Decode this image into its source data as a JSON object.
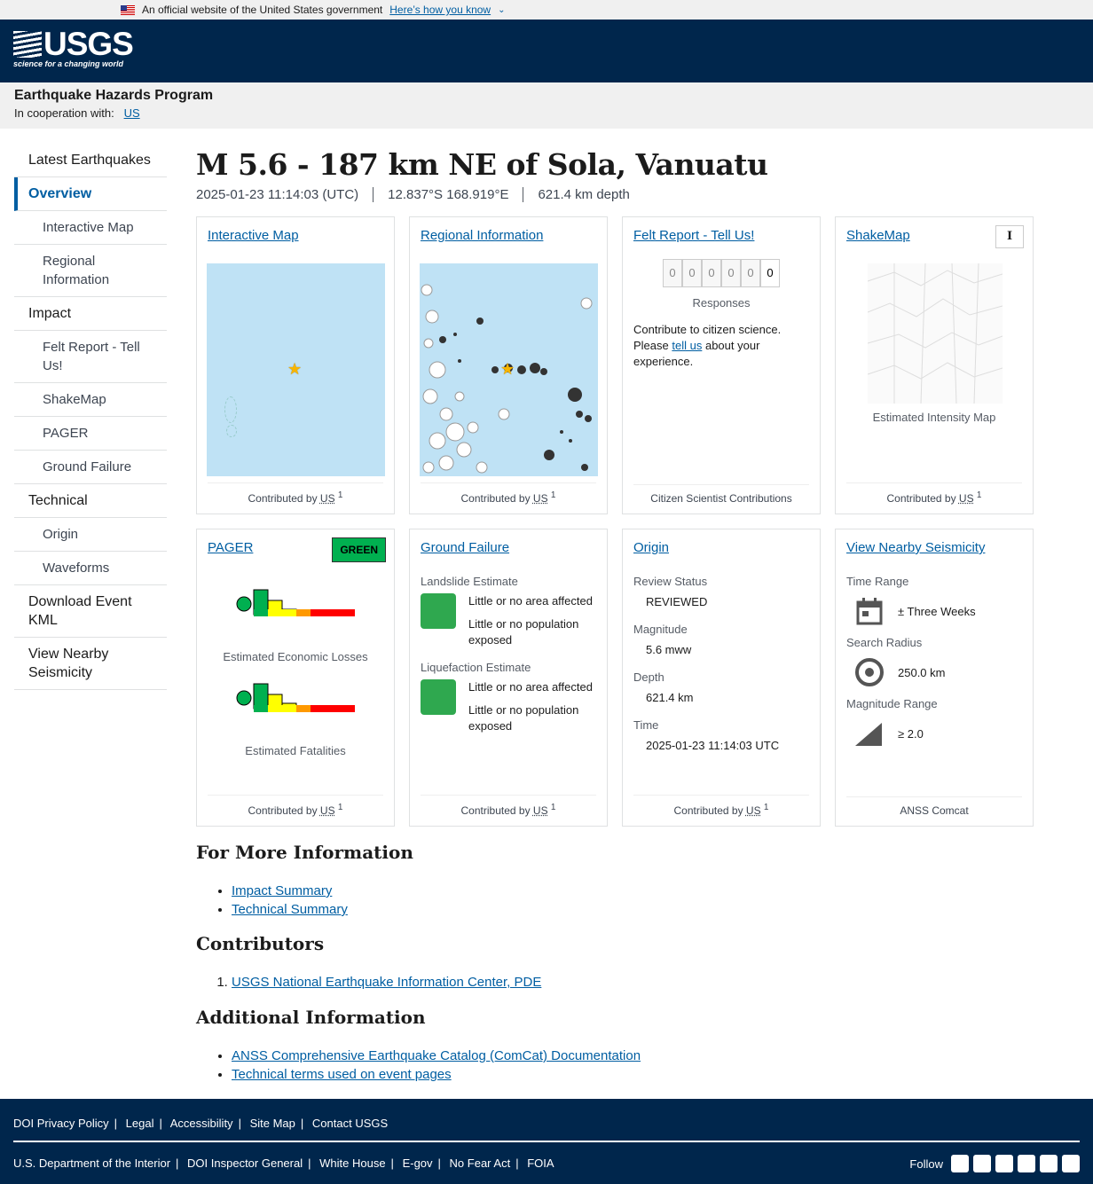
{
  "gov": {
    "text": "An official website of the United States government",
    "link": "Here’s how you know"
  },
  "brand": {
    "name": "USGS",
    "tagline": "science for a changing world"
  },
  "program": {
    "name": "Earthquake Hazards Program",
    "coop_label": "In cooperation with:",
    "coop_link": "US"
  },
  "nav": [
    {
      "label": "Latest Earthquakes"
    },
    {
      "label": "Overview"
    },
    {
      "label": "Interactive Map"
    },
    {
      "label": "Regional Information"
    },
    {
      "label": "Impact"
    },
    {
      "label": "Felt Report - Tell Us!"
    },
    {
      "label": "ShakeMap"
    },
    {
      "label": "PAGER"
    },
    {
      "label": "Ground Failure"
    },
    {
      "label": "Technical"
    },
    {
      "label": "Origin"
    },
    {
      "label": "Waveforms"
    },
    {
      "label": "Download Event KML"
    },
    {
      "label": "View Nearby Seismicity"
    }
  ],
  "event": {
    "title": "M 5.6 - 187 km NE of Sola, Vanuatu",
    "time": "2025-01-23 11:14:03 (UTC)",
    "location": "12.837°S 168.919°E",
    "depth": "621.4 km depth"
  },
  "cards": {
    "interactive_map": {
      "title": "Interactive Map",
      "foot": "Contributed by",
      "src": "US",
      "sup": "1"
    },
    "regional": {
      "title": "Regional Information",
      "foot": "Contributed by",
      "src": "US",
      "sup": "1"
    },
    "felt": {
      "title": "Felt Report - Tell Us!",
      "digits": [
        "0",
        "0",
        "0",
        "0",
        "0",
        "0"
      ],
      "responses": "Responses",
      "text1": "Contribute to citizen science. Please",
      "link": "tell us",
      "text2": "about your experience.",
      "foot": "Citizen Scientist Contributions"
    },
    "shakemap": {
      "title": "ShakeMap",
      "mmi": "I",
      "caption": "Estimated Intensity Map",
      "foot": "Contributed by",
      "src": "US",
      "sup": "1"
    },
    "pager": {
      "title": "PAGER",
      "alert": "GREEN",
      "cap1": "Estimated Economic Losses",
      "cap2": "Estimated Fatalities",
      "foot": "Contributed by",
      "src": "US",
      "sup": "1"
    },
    "ground": {
      "title": "Ground Failure",
      "ls_label": "Landslide Estimate",
      "ls_area": "Little or no area affected",
      "ls_pop": "Little or no population exposed",
      "lq_label": "Liquefaction Estimate",
      "lq_area": "Little or no area affected",
      "lq_pop": "Little or no population exposed",
      "foot": "Contributed by",
      "src": "US",
      "sup": "1"
    },
    "origin": {
      "title": "Origin",
      "review_label": "Review Status",
      "review": "REVIEWED",
      "mag_label": "Magnitude",
      "mag": "5.6 mww",
      "depth_label": "Depth",
      "depth": "621.4 km",
      "time_label": "Time",
      "time": "2025-01-23 11:14:03 UTC",
      "foot": "Contributed by",
      "src": "US",
      "sup": "1"
    },
    "nearby": {
      "title": "View Nearby Seismicity",
      "range_label": "Time Range",
      "range": "± Three Weeks",
      "radius_label": "Search Radius",
      "radius": "250.0 km",
      "mag_label": "Magnitude Range",
      "mag": "≥ 2.0",
      "foot": "ANSS Comcat"
    }
  },
  "more": {
    "title": "For More Information",
    "links": [
      "Impact Summary",
      "Technical Summary"
    ]
  },
  "contributors": {
    "title": "Contributors",
    "items": [
      "USGS National Earthquake Information Center, PDE"
    ]
  },
  "additional": {
    "title": "Additional Information",
    "links": [
      "ANSS Comprehensive Earthquake Catalog (ComCat) Documentation",
      "Technical terms used on event pages"
    ]
  },
  "footer": {
    "row1": [
      "DOI Privacy Policy",
      "Legal",
      "Accessibility",
      "Site Map",
      "Contact USGS"
    ],
    "row2": [
      "U.S. Department of the Interior",
      "DOI Inspector General",
      "White House",
      "E-gov",
      "No Fear Act",
      "FOIA"
    ],
    "follow": "Follow"
  }
}
